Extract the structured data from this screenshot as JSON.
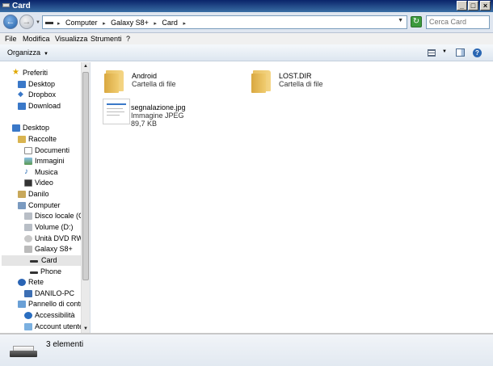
{
  "window": {
    "title": "Card"
  },
  "address": {
    "crumbs": [
      "Computer",
      "Galaxy S8+",
      "Card"
    ],
    "search_placeholder": "Cerca Card"
  },
  "menu": [
    "File",
    "Modifica",
    "Visualizza",
    "Strumenti",
    "?"
  ],
  "toolbar": {
    "organize_label": "Organizza"
  },
  "nav": {
    "items": [
      {
        "label": "Preferiti",
        "icon": "star-icon"
      },
      {
        "label": "Desktop",
        "icon": "desktop-icon"
      },
      {
        "label": "Dropbox",
        "icon": "dropbox-icon"
      },
      {
        "label": "Download",
        "icon": "download-icon"
      },
      {
        "label": "Desktop",
        "icon": "desktop-icon"
      },
      {
        "label": "Raccolte",
        "icon": "library-icon"
      },
      {
        "label": "Documenti",
        "icon": "document-icon"
      },
      {
        "label": "Immagini",
        "icon": "image-icon"
      },
      {
        "label": "Musica",
        "icon": "music-icon"
      },
      {
        "label": "Video",
        "icon": "video-icon"
      },
      {
        "label": "Danilo",
        "icon": "user-folder-icon"
      },
      {
        "label": "Computer",
        "icon": "computer-icon"
      },
      {
        "label": "Disco locale (C:)",
        "icon": "hard-drive-icon"
      },
      {
        "label": "Volume (D:)",
        "icon": "hard-drive-icon"
      },
      {
        "label": "Unità DVD RW (E",
        "icon": "dvd-drive-icon"
      },
      {
        "label": "Galaxy S8+",
        "icon": "phone-icon"
      },
      {
        "label": "Card",
        "icon": "card-icon"
      },
      {
        "label": "Phone",
        "icon": "card-icon"
      },
      {
        "label": "Rete",
        "icon": "network-icon"
      },
      {
        "label": "DANILO-PC",
        "icon": "pc-icon"
      },
      {
        "label": "Pannello di control",
        "icon": "control-panel-icon"
      },
      {
        "label": "Accessibilità",
        "icon": "accessibility-icon"
      },
      {
        "label": "Account utente",
        "icon": "user-accounts-icon"
      }
    ]
  },
  "files": [
    {
      "name": "Android",
      "type": "Cartella di file",
      "icon": "folder-icon"
    },
    {
      "name": "LOST.DIR",
      "type": "Cartella di file",
      "icon": "folder-icon"
    },
    {
      "name": "segnalazione.jpg",
      "type": "Immagine JPEG",
      "size": "89,7 KB",
      "icon": "image-thumbnail-icon"
    }
  ],
  "status": {
    "count": "3 elementi"
  }
}
